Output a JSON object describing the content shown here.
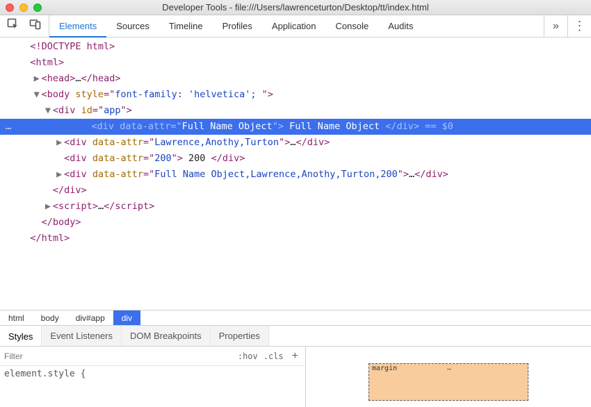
{
  "window": {
    "title": "Developer Tools - file:///Users/lawrenceturton/Desktop/tt/index.html"
  },
  "toolbar": {
    "tabs": [
      "Elements",
      "Sources",
      "Timeline",
      "Profiles",
      "Application",
      "Console",
      "Audits"
    ],
    "active": "Elements",
    "overflow": "»",
    "menu": "⋮"
  },
  "dom": {
    "lines": [
      {
        "indent": 1,
        "tri": "",
        "pre": "<!DOCTYPE html>",
        "plain": true
      },
      {
        "indent": 1,
        "tri": "",
        "open": "html"
      },
      {
        "indent": 2,
        "tri": "▶",
        "open": "head",
        "ellip": true,
        "close": "head"
      },
      {
        "indent": 2,
        "tri": "▼",
        "open": "body",
        "attrs": [
          {
            "n": "style",
            "v": "font-family: 'helvetica'; "
          }
        ]
      },
      {
        "indent": 3,
        "tri": "▼",
        "open": "div",
        "attrs": [
          {
            "n": "id",
            "v": "app"
          }
        ]
      },
      {
        "indent": 4,
        "tri": "",
        "open": "div",
        "attrs": [
          {
            "n": "data-attr",
            "v": "Full Name Object"
          }
        ],
        "text": " Full Name Object ",
        "close": "div",
        "selected": true,
        "suffix": " == $0"
      },
      {
        "indent": 4,
        "tri": "▶",
        "open": "div",
        "attrs": [
          {
            "n": "data-attr",
            "v": "Lawrence,Anothy,Turton"
          }
        ],
        "ellip": true,
        "close": "div"
      },
      {
        "indent": 4,
        "tri": "",
        "open": "div",
        "attrs": [
          {
            "n": "data-attr",
            "v": "200"
          }
        ],
        "text": " 200 ",
        "close": "div"
      },
      {
        "indent": 4,
        "tri": "▶",
        "open": "div",
        "attrs": [
          {
            "n": "data-attr",
            "v": "Full Name Object,Lawrence,Anothy,Turton,200"
          }
        ],
        "ellip": true,
        "close": "div"
      },
      {
        "indent": 3,
        "tri": "",
        "closeOnly": "div"
      },
      {
        "indent": 3,
        "tri": "▶",
        "open": "script",
        "ellip": true,
        "close": "script"
      },
      {
        "indent": 2,
        "tri": "",
        "closeOnly": "body"
      },
      {
        "indent": 1,
        "tri": "",
        "closeOnly": "html"
      }
    ],
    "selected_gutter": "…"
  },
  "breadcrumbs": [
    "html",
    "body",
    "div#app",
    "div"
  ],
  "breadcrumb_active": 3,
  "subtabs": [
    "Styles",
    "Event Listeners",
    "DOM Breakpoints",
    "Properties"
  ],
  "subtab_active": 0,
  "filter": {
    "placeholder": "Filter",
    "hov": ":hov",
    "cls": ".cls",
    "plus": "+"
  },
  "rule": "element.style {",
  "boxmodel": {
    "label": "margin",
    "top": "–"
  }
}
